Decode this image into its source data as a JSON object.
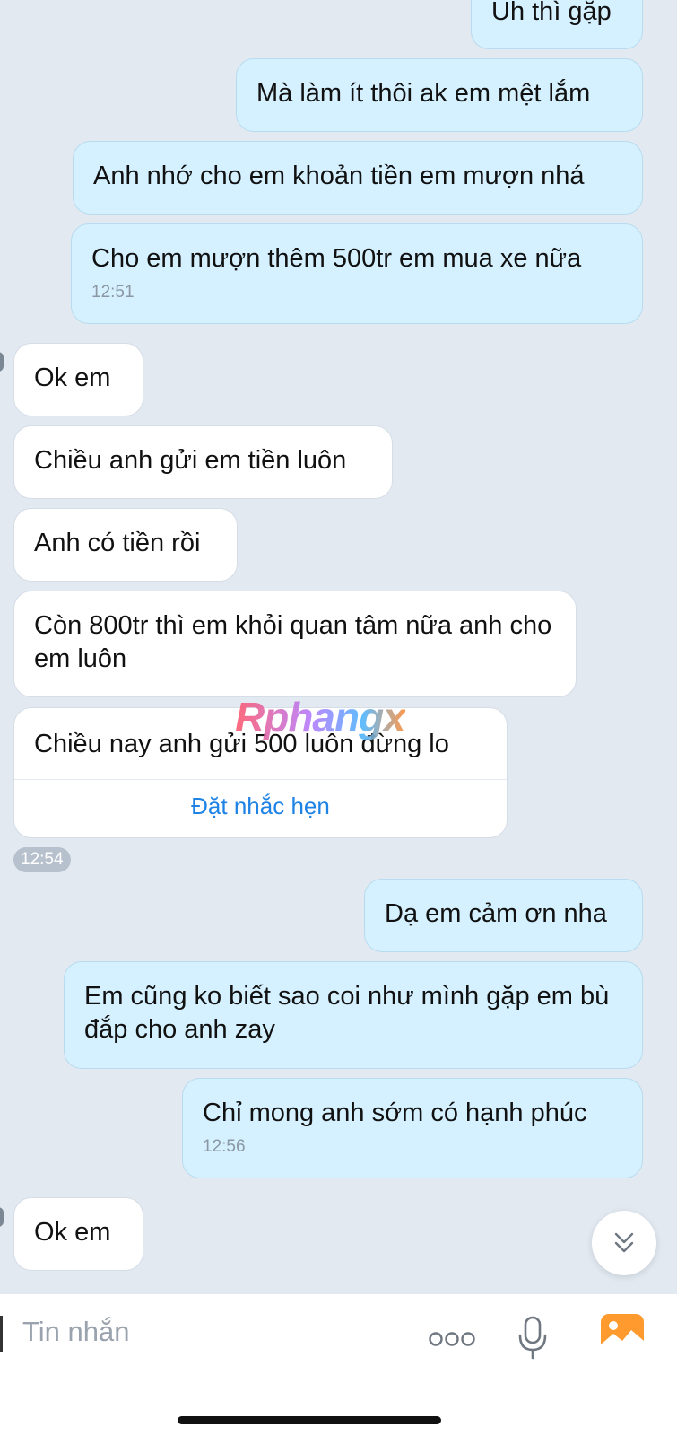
{
  "messages": {
    "m1": "Uh thì gặp",
    "m2": "Mà làm ít thôi ak em mệt lắm",
    "m3": "Anh nhớ cho em khoản tiền em mượn nhá",
    "m4": "Cho em mượn thêm 500tr em mua xe nữa",
    "m4_time": "12:51",
    "r1": "Ok em",
    "r2": "Chiều anh gửi em tiền luôn",
    "r3": "Anh có tiền rồi",
    "r4": "Còn 800tr thì em khỏi quan tâm nữa anh cho em luôn",
    "r5": "Chiều nay anh gửi 500 luôn đừng lo",
    "r5_action": "Đặt nhắc hẹn",
    "r5_time": "12:54",
    "m5": "Dạ em cảm ơn nha",
    "m6": "Em cũng ko biết sao coi như mình gặp em bù đắp cho anh zay",
    "m7": "Chỉ mong anh sớm có hạnh phúc",
    "m7_time": "12:56",
    "r6": "Ok em"
  },
  "watermark": "Rphangx",
  "input": {
    "placeholder": "Tin nhắn"
  },
  "icons": {
    "scroll_down": "double-chevron-down-icon",
    "more": "more-dots-icon",
    "mic": "microphone-icon",
    "image": "image-icon"
  },
  "colors": {
    "outgoing_bubble": "#d5f1ff",
    "incoming_bubble": "#ffffff",
    "chat_background": "#e2e9f1",
    "link_blue": "#1f83e6",
    "image_icon_orange": "#ff9a2e"
  }
}
